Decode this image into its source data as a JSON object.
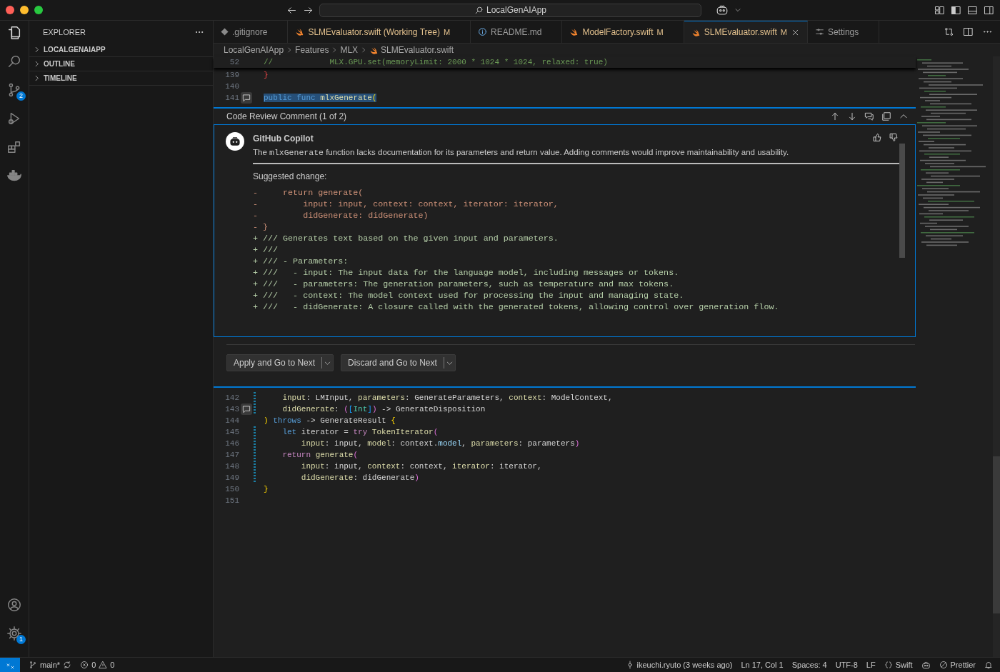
{
  "title_bar": {
    "search": "LocalGenAIApp"
  },
  "activity_bar": {
    "items": [
      {
        "kind": "files",
        "selected": true
      },
      {
        "kind": "search",
        "selected": false
      },
      {
        "kind": "scm",
        "selected": false,
        "badge": "2"
      },
      {
        "kind": "debug",
        "selected": false
      },
      {
        "kind": "extensions",
        "selected": false
      },
      {
        "kind": "docker",
        "selected": false
      }
    ],
    "bottom": [
      {
        "kind": "account"
      },
      {
        "kind": "settings",
        "badge": "1"
      }
    ]
  },
  "sidebar": {
    "title": "EXPLORER",
    "sections": [
      {
        "label": "LOCALGENAIAPP",
        "expanded": false
      },
      {
        "label": "OUTLINE",
        "expanded": false
      },
      {
        "label": "TIMELINE",
        "expanded": false
      }
    ]
  },
  "tabs": [
    {
      "label": ".gitignore",
      "kind": "git",
      "selected": false
    },
    {
      "label": "SLMEvaluator.swift (Working Tree)",
      "kind": "swift",
      "badge": "M",
      "selected": false
    },
    {
      "label": "README.md",
      "kind": "info",
      "selected": false
    },
    {
      "label": "ModelFactory.swift",
      "kind": "swift",
      "badge": "M",
      "selected": false
    },
    {
      "label": "SLMEvaluator.swift",
      "kind": "swift",
      "badge": "M",
      "selected": true
    },
    {
      "label": "Settings",
      "kind": "settings",
      "selected": false
    }
  ],
  "breadcrumb": [
    "LocalGenAIApp",
    "Features",
    "MLX",
    "SLMEvaluator.swift"
  ],
  "sticky_line": {
    "number": "52",
    "tokens": [
      {
        "text": "//            MLX.GPU.set(memoryLimit: 2000 * 1024 * 1024, relaxed: true)",
        "kind": "comment"
      }
    ]
  },
  "lines_above": [
    {
      "number": "139",
      "tokens": [
        {
          "text": "}",
          "kind": "error"
        }
      ]
    },
    {
      "number": "140"
    },
    {
      "number": "141",
      "comment": true,
      "highlighted": true,
      "tokens": [
        {
          "text": "public func ",
          "kind": "keyword"
        },
        {
          "text": "mlxGenerate",
          "kind": "function"
        },
        {
          "text": "(",
          "kind": "brace"
        }
      ]
    }
  ],
  "review": {
    "title": "Code Review Comment (1 of 2)",
    "author": "GitHub Copilot",
    "body": [
      {
        "text": "The ",
        "kind": "text"
      },
      {
        "text": "mlxGenerate",
        "kind": "code"
      },
      {
        "text": " function lacks documentation for its parameters and return value. Adding comments would improve maintainability and usability.",
        "kind": "text"
      }
    ],
    "suggestion_label": "Suggested change:",
    "diff": [
      {
        "kind": "removed",
        "text": "-     return generate("
      },
      {
        "kind": "removed",
        "text": "-         input: input, context: context, iterator: iterator,"
      },
      {
        "kind": "removed",
        "text": "-         didGenerate: didGenerate)"
      },
      {
        "kind": "removed",
        "text": "- }"
      },
      {
        "kind": "added",
        "text": "+ /// Generates text based on the given input and parameters."
      },
      {
        "kind": "added",
        "text": "+ ///"
      },
      {
        "kind": "added",
        "text": "+ /// - Parameters:"
      },
      {
        "kind": "added",
        "text": "+ ///   - input: The input data for the language model, including messages or tokens."
      },
      {
        "kind": "added",
        "text": "+ ///   - parameters: The generation parameters, such as temperature and max tokens."
      },
      {
        "kind": "added",
        "text": "+ ///   - context: The model context used for processing the input and managing state."
      },
      {
        "kind": "added",
        "text": "+ ///   - didGenerate: A closure called with the generated tokens, allowing control over generation flow."
      }
    ],
    "actions": [
      "Apply and Go to Next",
      "Discard and Go to Next"
    ]
  },
  "lines_below": [
    {
      "number": "142",
      "changed": true,
      "tokens": [
        {
          "text": "    input",
          "kind": "param"
        },
        {
          "text": ": LMInput, ",
          "kind": "text"
        },
        {
          "text": "parameters",
          "kind": "param"
        },
        {
          "text": ": GenerateParameters, ",
          "kind": "text"
        },
        {
          "text": "context",
          "kind": "param"
        },
        {
          "text": ": ModelContext,",
          "kind": "text"
        }
      ]
    },
    {
      "number": "143",
      "changed": true,
      "comment": true,
      "tokens": [
        {
          "text": "    didGenerate",
          "kind": "param"
        },
        {
          "text": ": ",
          "kind": "text"
        },
        {
          "text": "(",
          "kind": "paren"
        },
        {
          "text": "[",
          "kind": "bracket"
        },
        {
          "text": "Int",
          "kind": "type"
        },
        {
          "text": "]",
          "kind": "bracket"
        },
        {
          "text": ")",
          "kind": "paren"
        },
        {
          "text": " -> GenerateDisposition",
          "kind": "text"
        }
      ]
    },
    {
      "number": "144",
      "tokens": [
        {
          "text": ")",
          "kind": "brace"
        },
        {
          "text": " throws",
          "kind": "keyword"
        },
        {
          "text": " -> GenerateResult ",
          "kind": "text"
        },
        {
          "text": "{",
          "kind": "brace"
        }
      ]
    },
    {
      "number": "145",
      "changed": true,
      "tokens": [
        {
          "text": "    let",
          "kind": "keyword"
        },
        {
          "text": " iterator = ",
          "kind": "text"
        },
        {
          "text": "try ",
          "kind": "control"
        },
        {
          "text": "TokenIterator",
          "kind": "function"
        },
        {
          "text": "(",
          "kind": "paren"
        }
      ]
    },
    {
      "number": "146",
      "changed": true,
      "tokens": [
        {
          "text": "        input",
          "kind": "param"
        },
        {
          "text": ": input, ",
          "kind": "text"
        },
        {
          "text": "model",
          "kind": "param"
        },
        {
          "text": ": context.",
          "kind": "text"
        },
        {
          "text": "model",
          "kind": "property"
        },
        {
          "text": ", ",
          "kind": "text"
        },
        {
          "text": "parameters",
          "kind": "param"
        },
        {
          "text": ": parameters",
          "kind": "text"
        },
        {
          "text": ")",
          "kind": "paren"
        }
      ]
    },
    {
      "number": "147",
      "changed": true,
      "tokens": [
        {
          "text": "    return ",
          "kind": "control"
        },
        {
          "text": "generate",
          "kind": "function"
        },
        {
          "text": "(",
          "kind": "paren"
        }
      ]
    },
    {
      "number": "148",
      "changed": true,
      "tokens": [
        {
          "text": "        input",
          "kind": "param"
        },
        {
          "text": ": input, ",
          "kind": "text"
        },
        {
          "text": "context",
          "kind": "param"
        },
        {
          "text": ": context, ",
          "kind": "text"
        },
        {
          "text": "iterator",
          "kind": "param"
        },
        {
          "text": ": iterator,",
          "kind": "text"
        }
      ]
    },
    {
      "number": "149",
      "changed": true,
      "tokens": [
        {
          "text": "        didGenerate",
          "kind": "param"
        },
        {
          "text": ": didGenerate",
          "kind": "text"
        },
        {
          "text": ")",
          "kind": "paren"
        }
      ]
    },
    {
      "number": "150",
      "tokens": [
        {
          "text": "}",
          "kind": "brace"
        }
      ]
    },
    {
      "number": "151"
    }
  ],
  "status_bar": {
    "branch": "main*",
    "errors": "0",
    "warnings": "0",
    "blame": "ikeuchi.ryuto (3 weeks ago)",
    "position": "Ln 17, Col 1",
    "indent": "Spaces: 4",
    "encoding": "UTF-8",
    "eol": "LF",
    "language": "Swift",
    "formatter": "Prettier"
  }
}
